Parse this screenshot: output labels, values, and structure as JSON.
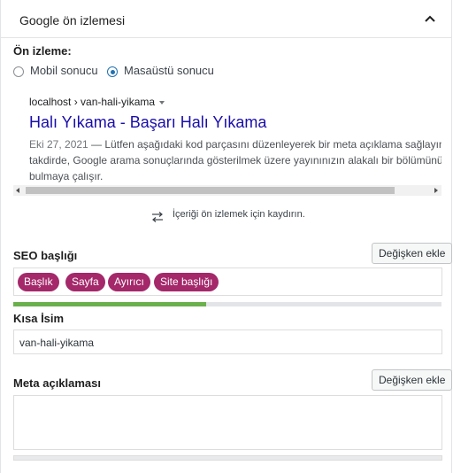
{
  "panel": {
    "title": "Google ön izlemesi"
  },
  "preview_mode": {
    "label": "Ön izleme:",
    "options": [
      "Mobil sonucu",
      "Masaüstü sonucu"
    ],
    "selected": "Masaüstü sonucu"
  },
  "snippet": {
    "url": "localhost › van-hali-yikama",
    "title": "Halı Yıkama - Başarı Halı Yıkama",
    "date": "Eki 27, 2021",
    "desc_line1": " — Lütfen aşağıdaki kod parçasını düzenleyerek bir meta açıklama sağlayın",
    "desc_line2": "takdirde, Google arama sonuçlarında gösterilmek üzere yayınınızın alakalı bir bölümünü",
    "desc_line3": "bulmaya çalışır."
  },
  "scroll_hint": "İçeriği ön izlemek için kaydırın.",
  "seo_title": {
    "label": "SEO başlığı",
    "button": "Değişken ekle",
    "tags": [
      "Başlık",
      "Sayfa",
      "Ayırıcı",
      "Site başlığı"
    ],
    "progress": 0.45,
    "progress_color": "#6ab04c"
  },
  "slug": {
    "label": "Kısa İsim",
    "value": "van-hali-yikama"
  },
  "meta": {
    "label": "Meta açıklaması",
    "button": "Değişken ekle",
    "value": ""
  },
  "colors": {
    "tag": "#a4286a",
    "link": "#1a0dab",
    "radio": "#2271b1"
  }
}
